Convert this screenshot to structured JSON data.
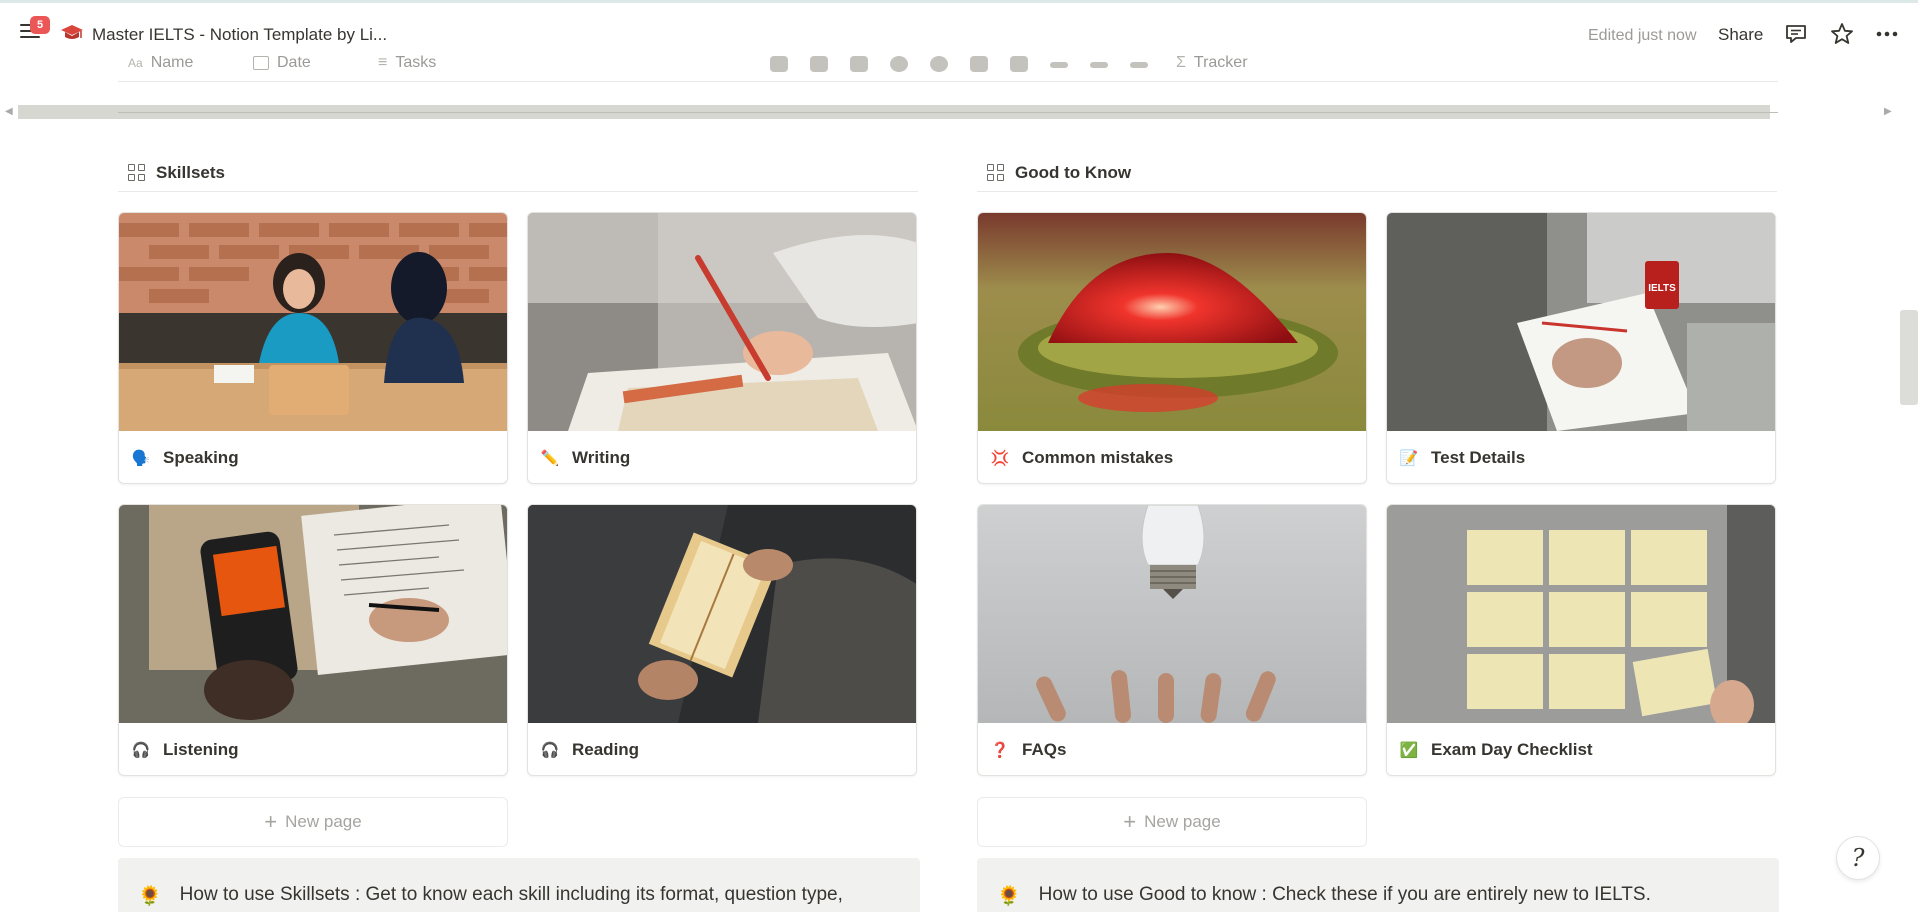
{
  "topbar": {
    "notification_count": "5",
    "title": "Master IELTS - Notion Template by Li...",
    "edited": "Edited just now",
    "share_label": "Share"
  },
  "db_header": {
    "columns": [
      "Name",
      "Date",
      "Tasks",
      "Tracker"
    ]
  },
  "skillsets": {
    "title": "Skillsets",
    "cards": [
      {
        "label": "Speaking",
        "emoji": "🗣️"
      },
      {
        "label": "Writing",
        "emoji": "✏️"
      },
      {
        "label": "Listening",
        "emoji": "🎧"
      },
      {
        "label": "Reading",
        "emoji": "🎧"
      }
    ],
    "new_page_label": "New page",
    "callout": "How to use Skillsets : Get to know each skill including its format, question type,"
  },
  "good_to_know": {
    "title": "Good to Know",
    "cards": [
      {
        "label": "Common mistakes",
        "emoji": "💢"
      },
      {
        "label": "Test Details",
        "emoji": "📝"
      },
      {
        "label": "FAQs",
        "emoji": "❓"
      },
      {
        "label": "Exam Day Checklist",
        "emoji": "✅"
      }
    ],
    "new_page_label": "New page",
    "callout": "How to use Good to know : Check these if you are entirely new to IELTS."
  },
  "callout_icon": "🌻",
  "colors": {
    "text": "#37352f",
    "muted": "#9b9a97",
    "badge": "#eb5757",
    "callout_bg": "#f1f1ef"
  }
}
